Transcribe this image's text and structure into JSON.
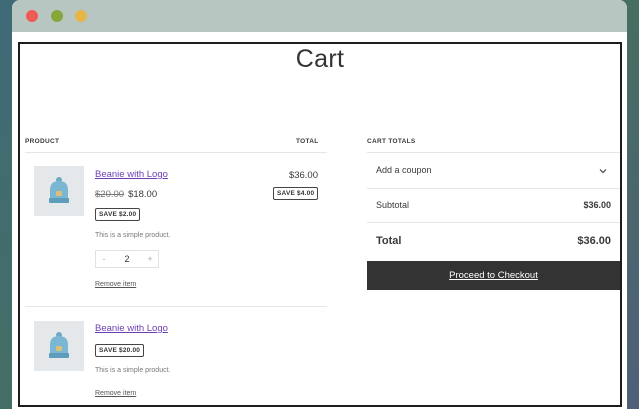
{
  "page": {
    "title": "Cart"
  },
  "table": {
    "product_header": "PRODUCT",
    "total_header": "TOTAL"
  },
  "items": [
    {
      "name": "Beanie with Logo",
      "regular_price": "$20.00",
      "sale_price": "$18.00",
      "save_badge": "SAVE $2.00",
      "description": "This is a simple product.",
      "quantity": "2",
      "qty_minus": "-",
      "qty_plus": "+",
      "remove_label": "Remove item",
      "line_total": "$36.00",
      "line_save_badge": "SAVE $4.00"
    },
    {
      "name": "Beanie with Logo",
      "save_badge": "SAVE $20.00",
      "description": "This is a simple product.",
      "remove_label": "Remove item"
    }
  ],
  "cart_totals": {
    "heading": "CART TOTALS",
    "coupon_label": "Add a coupon",
    "subtotal_label": "Subtotal",
    "subtotal_value": "$36.00",
    "total_label": "Total",
    "total_value": "$36.00",
    "checkout_label": "Proceed to Checkout"
  },
  "colors": {
    "link": "#6d3fb3",
    "checkout_bg": "#333333",
    "thumb_bg": "#e5e8ea",
    "window_dot_close": "#ef5a52",
    "window_dot_minimize": "#86a83b",
    "window_dot_zoom": "#e6b648"
  },
  "icons": {
    "product_image": "beanie-icon",
    "coupon_toggle": "chevron-down-icon"
  }
}
